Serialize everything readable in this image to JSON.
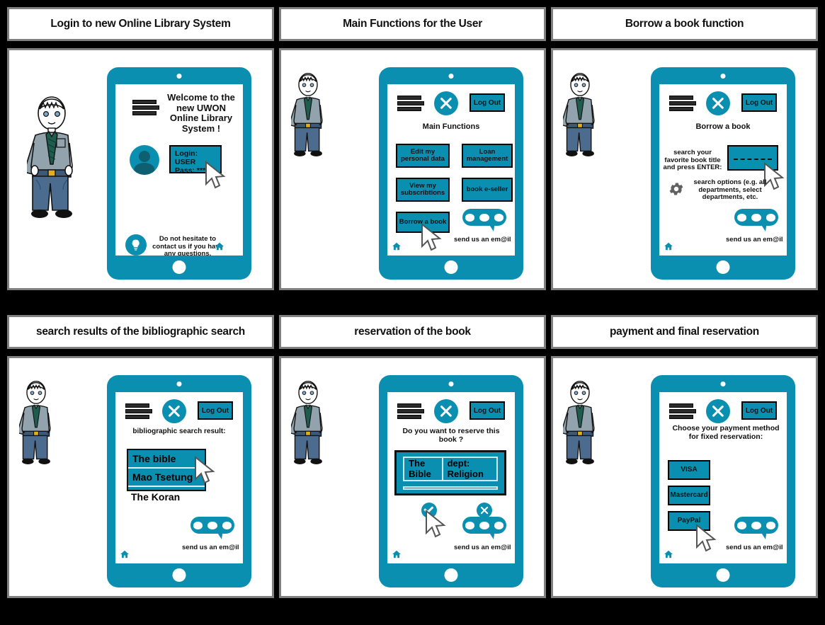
{
  "theme": {
    "accent": "#0b8fb0",
    "background": "#000000",
    "panel": "#ffffff",
    "border": "#808080"
  },
  "panels": [
    {
      "id": "login",
      "title": "Login to new Online Library System",
      "welcome": "Welcome to the new UWON Online Library System !",
      "login_label": "Login: USER",
      "pass_label": "Pass: *****",
      "help_text": "Do not hesitate to contact us if you have any questions.",
      "icons": [
        "books-icon",
        "avatar-icon",
        "lightbulb-icon",
        "home-icon",
        "cursor-pointer"
      ]
    },
    {
      "id": "main-functions",
      "title": "Main Functions for the User",
      "logout_label": "Log Out",
      "heading": "Main Functions",
      "buttons": [
        "Edit my personal data",
        "Loan management",
        "View my subscribtions",
        "book e-seller",
        "Borrow a book"
      ],
      "email_label": "send us an em@il",
      "icons": [
        "books-icon",
        "close-x-icon",
        "chat-bubble-icon",
        "home-icon",
        "cursor-pointer"
      ]
    },
    {
      "id": "borrow-book",
      "title": "Borrow a book function",
      "logout_label": "Log Out",
      "heading": "Borrow a book",
      "search_prompt": "search your favorite book title and press ENTER:",
      "search_placeholder": "- - - - - - - - -",
      "options_text": "search options (e.g. all departments, select departments, etc.",
      "email_label": "send us an em@il",
      "icons": [
        "books-icon",
        "close-x-icon",
        "gear-icon",
        "chat-bubble-icon",
        "home-icon",
        "cursor-pointer"
      ]
    },
    {
      "id": "search-results",
      "title": "search results of the bibliographic search",
      "logout_label": "Log Out",
      "heading": "bibliographic search result:",
      "results": [
        "The bible",
        "Mao Tsetung",
        "The Koran"
      ],
      "email_label": "send us an em@il",
      "icons": [
        "books-icon",
        "close-x-icon",
        "chat-bubble-icon",
        "home-icon",
        "cursor-pointer"
      ]
    },
    {
      "id": "reservation",
      "title": "reservation of the book",
      "logout_label": "Log Out",
      "heading": "Do you want to reserve this book ?",
      "book_title": "The Bible",
      "book_dept": "dept: Religion",
      "email_label": "send us an em@il",
      "icons": [
        "books-icon",
        "close-x-icon",
        "check-confirm-icon",
        "cancel-x-icon",
        "chat-bubble-icon",
        "home-icon",
        "cursor-pointer"
      ]
    },
    {
      "id": "payment",
      "title": "payment and final reservation",
      "logout_label": "Log Out",
      "heading": "Choose your payment method for fixed reservation:",
      "methods": [
        "VISA",
        "Mastercard",
        "PayPal"
      ],
      "email_label": "send us an em@il",
      "icons": [
        "books-icon",
        "close-x-icon",
        "chat-bubble-icon",
        "home-icon",
        "cursor-pointer"
      ]
    }
  ]
}
